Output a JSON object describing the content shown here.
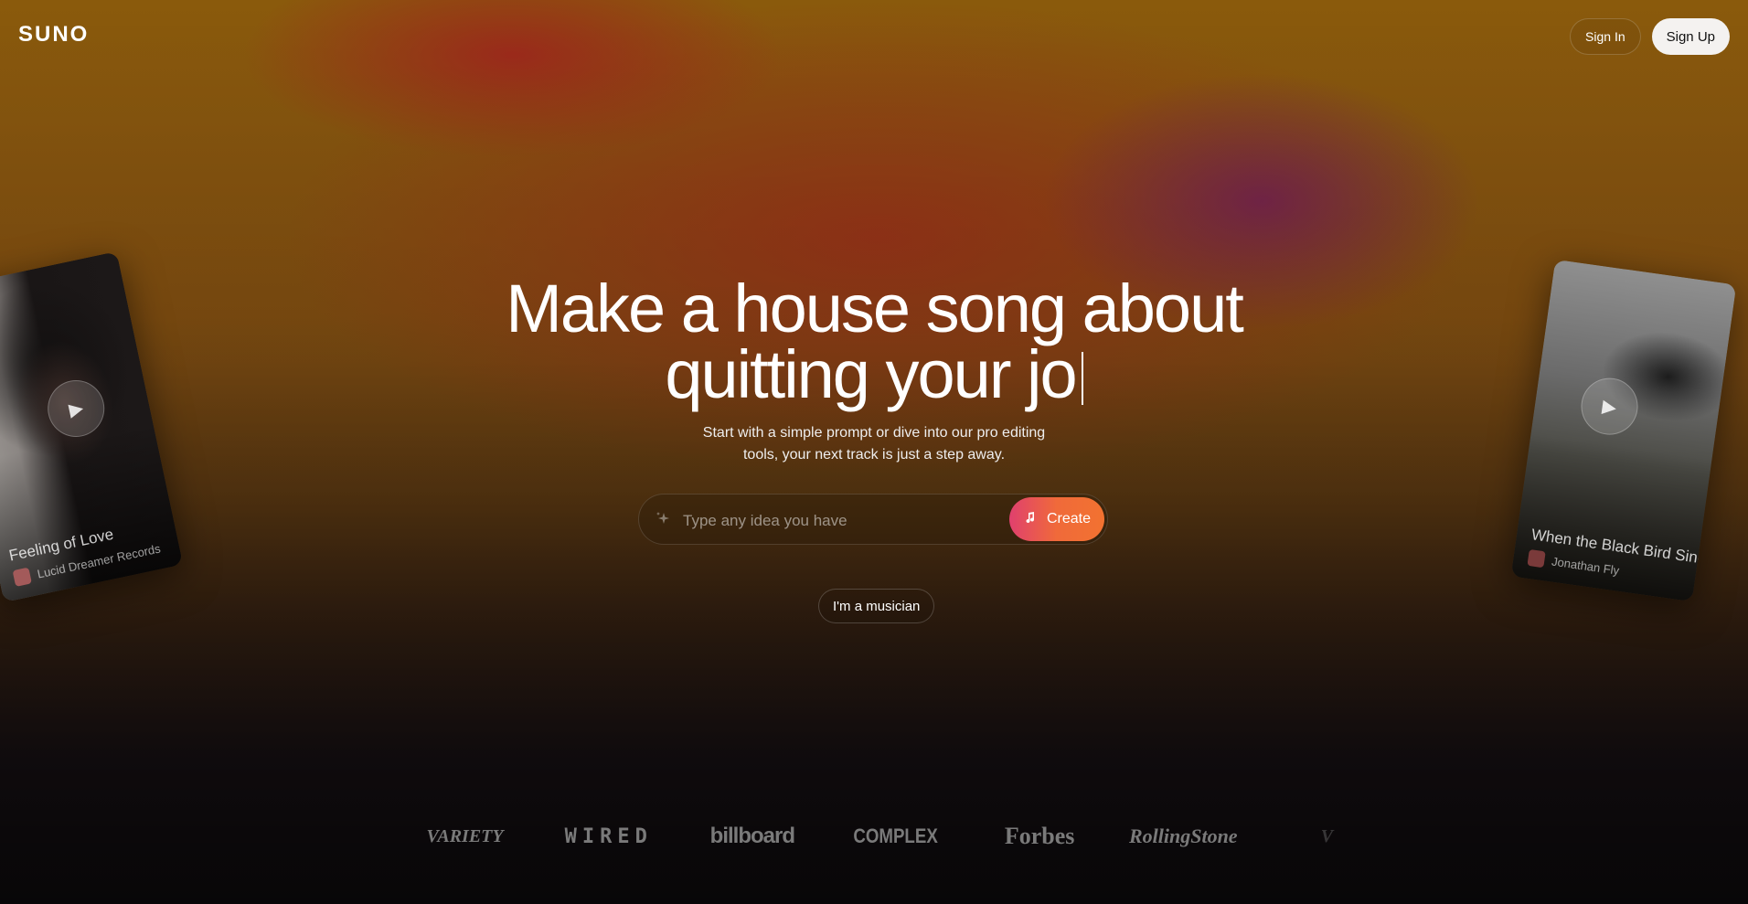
{
  "brand": {
    "logo": "SUNO"
  },
  "nav": {
    "sign_in": "Sign In",
    "sign_up": "Sign Up"
  },
  "hero": {
    "headline_line1": "Make a house song about",
    "headline_line2": "quitting your jo",
    "subtitle_line1": "Start with a simple prompt or dive into our pro editing",
    "subtitle_line2": "tools, your next track is just a step away."
  },
  "prompt": {
    "placeholder": "Type any idea you have",
    "create_label": "Create"
  },
  "musician_label": "I'm a musician",
  "cards": {
    "left": {
      "title": "Feeling of Love",
      "artist": "Lucid Dreamer Records"
    },
    "right": {
      "title": "When the Black Bird Sings",
      "artist": "Jonathan Fly"
    }
  },
  "press_logos": [
    "VARIETY",
    "WIRED",
    "billboard",
    "COMPLEX",
    "Forbes",
    "RollingStone",
    "V"
  ]
}
